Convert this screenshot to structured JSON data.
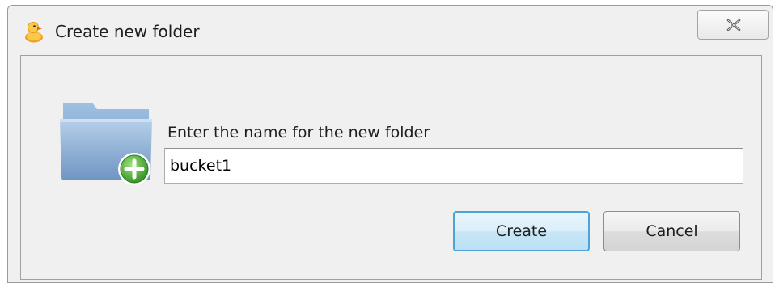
{
  "window": {
    "title": "Create new folder",
    "app_icon": "duck-icon",
    "close_icon": "close-icon"
  },
  "dialog": {
    "icon": "folder-add-icon",
    "prompt": "Enter the name for the new folder",
    "folder_name_value": "bucket1",
    "create_label": "Create",
    "cancel_label": "Cancel"
  },
  "colors": {
    "primary_button_border": "#4ea3d6",
    "folder_blue": "#7ba3cf",
    "plus_green": "#3fa32c"
  }
}
